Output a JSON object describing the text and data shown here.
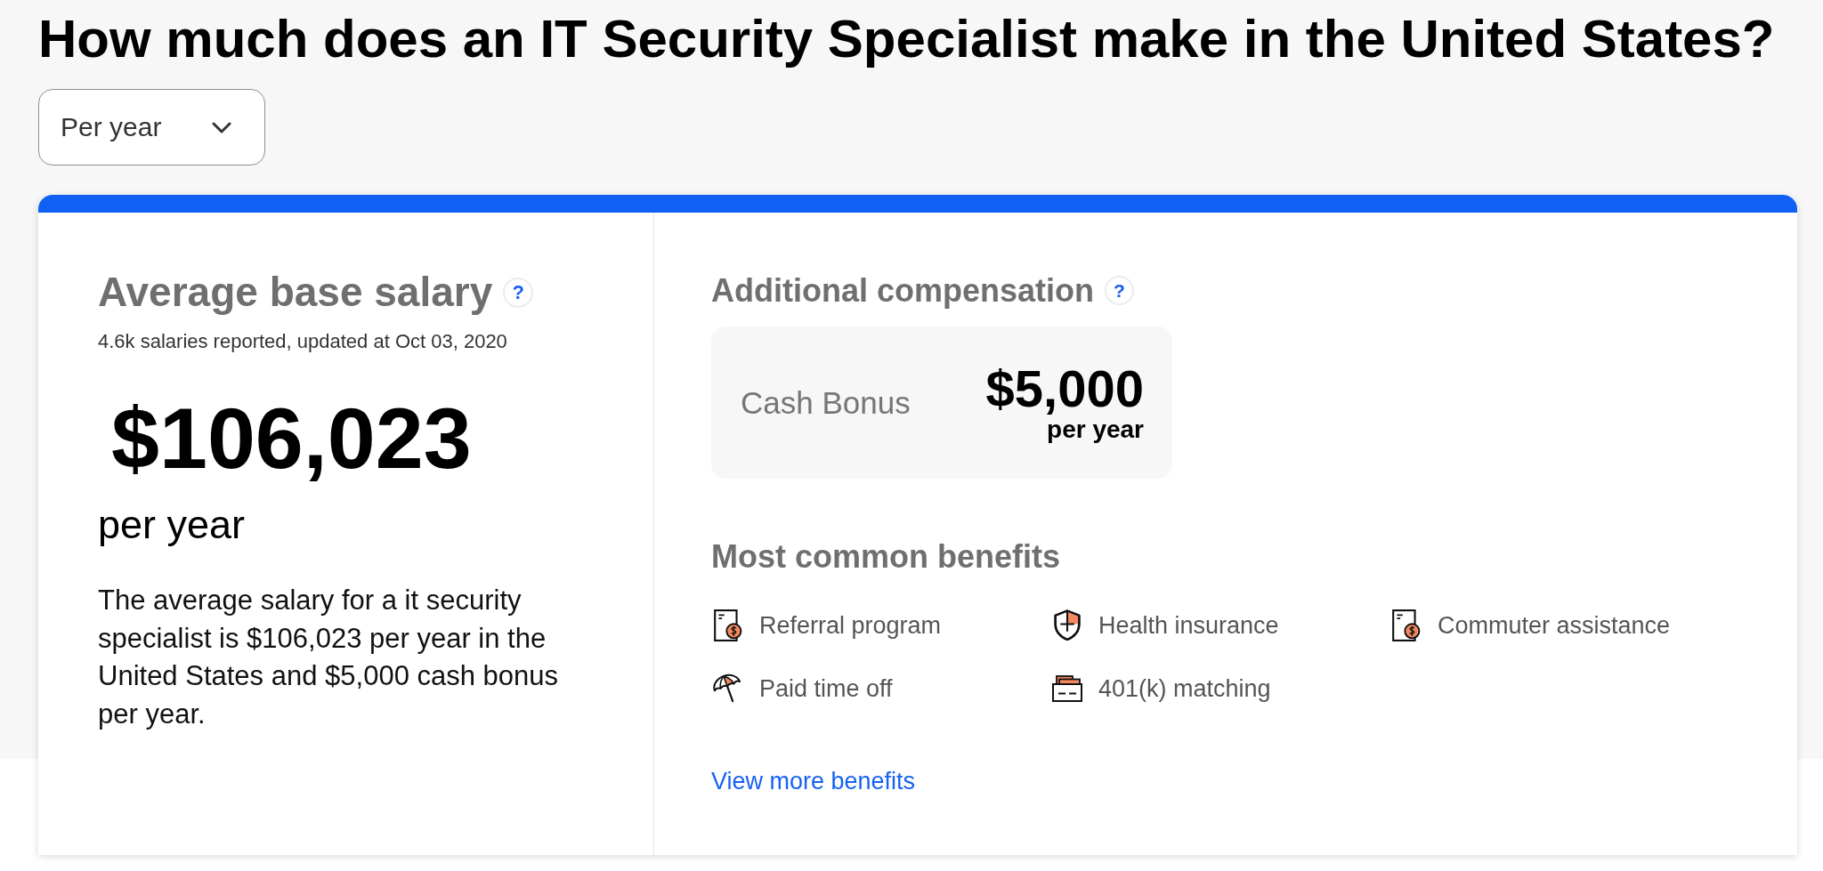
{
  "page": {
    "title": "How much does an IT Security Specialist make in the United States?"
  },
  "pay_period": {
    "value": "Per year"
  },
  "base_salary": {
    "heading": "Average base salary",
    "help": "?",
    "reported": "4.6k salaries reported, updated at Oct 03, 2020",
    "amount": "$106,023",
    "period": "per year",
    "summary": "The average salary for a it security specialist is $106,023 per year in the United States and $5,000 cash bonus per year."
  },
  "additional_compensation": {
    "heading": "Additional compensation",
    "help": "?",
    "items": [
      {
        "label": "Cash Bonus",
        "amount": "$5,000",
        "period": "per year"
      }
    ]
  },
  "benefits": {
    "heading": "Most common benefits",
    "items": [
      {
        "label": "Referral program",
        "kind": "receipt"
      },
      {
        "label": "Health insurance",
        "kind": "shield"
      },
      {
        "label": "Commuter assistance",
        "kind": "receipt"
      },
      {
        "label": "Paid time off",
        "kind": "umbrella"
      },
      {
        "label": "401(k) matching",
        "kind": "tray"
      }
    ],
    "link": "View more benefits"
  }
}
